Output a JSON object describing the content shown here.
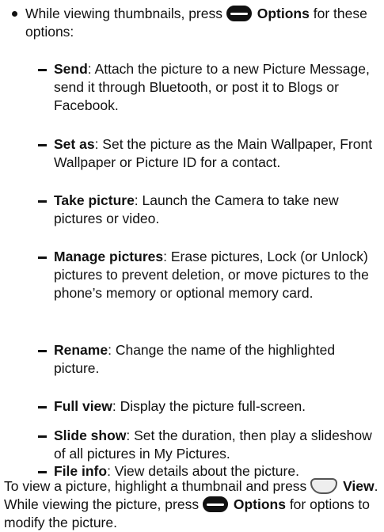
{
  "bullet": {
    "prefix": "While viewing thumbnails, press",
    "key_label": "Options",
    "suffix": "for these options:"
  },
  "options": [
    {
      "name": "Send",
      "desc": ": Attach the picture to a new Picture Message, send it through Bluetooth, or post it to Blogs or Facebook."
    },
    {
      "name": "Set as",
      "desc": ": Set the picture as the Main Wallpaper, Front Wallpaper or Picture ID for a contact."
    },
    {
      "name": "Take picture",
      "desc": ": Launch the Camera to take new pictures or video."
    },
    {
      "name": "Manage pictures",
      "desc": ": Erase pictures, Lock (or Unlock) pictures to prevent deletion, or move pictures to the phone’s memory or optional memory card."
    },
    {
      "name": "Rename",
      "desc": ": Change the name of the highlighted picture."
    },
    {
      "name": "Full view",
      "desc": ": Display the picture full-screen."
    },
    {
      "name": "Slide show",
      "desc": ": Set the duration, then play a slideshow of all pictures in My Pictures."
    },
    {
      "name": "File info",
      "desc": ": View details about the picture."
    }
  ],
  "footer": {
    "part1": "To view a picture, highlight a thumbnail and press",
    "view_label": "View",
    "part2": ". While viewing the picture, press",
    "options_label": "Options",
    "part3": "for options to modify the picture."
  },
  "icons": {
    "left_softkey": "left-softkey-icon",
    "center_key": "center-ok-key-icon"
  }
}
